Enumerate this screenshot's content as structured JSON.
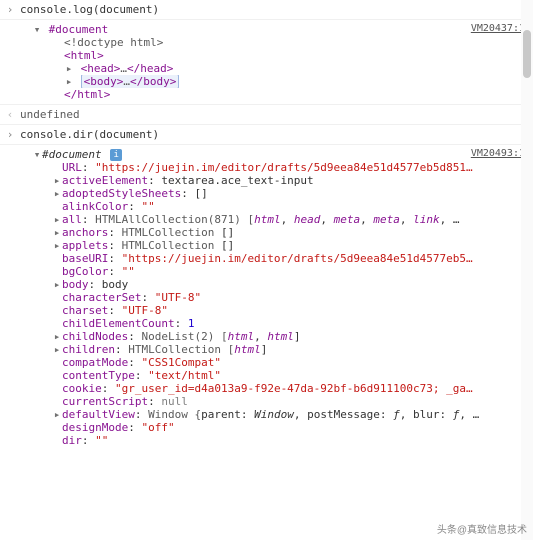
{
  "input1": {
    "code": "console.log(document)",
    "source": "VM20437:1"
  },
  "tree1": {
    "root": "#document",
    "doctype": "<!doctype html>",
    "html_open": "<html>",
    "head": {
      "open": "<head>",
      "ell": "…",
      "close": "</head>"
    },
    "body": {
      "open": "<body>",
      "ell": "…",
      "close": "</body>"
    },
    "html_close": "</html>"
  },
  "return1": "undefined",
  "input2": {
    "code": "console.dir(document)",
    "source": "VM20493:1"
  },
  "tree2": {
    "root": "#document",
    "props": {
      "URL": {
        "type": "str",
        "val": "\"https://juejin.im/editor/drafts/5d9eea84e51d4577eb5d851…"
      },
      "activeElement": {
        "type": "obj",
        "val": "textarea.ace_text-input",
        "expandable": true
      },
      "adoptedStyleSheets": {
        "type": "obj",
        "val": "[]",
        "expandable": true
      },
      "alinkColor": {
        "type": "str",
        "val": "\"\""
      },
      "all": {
        "type": "coll",
        "prefix": "HTMLAllCollection(871) [",
        "items": [
          "html",
          "head",
          "meta",
          "meta",
          "link"
        ],
        "trail": ", …",
        "expandable": true
      },
      "anchors": {
        "type": "coll",
        "prefix": "HTMLCollection ",
        "val": "[]",
        "expandable": true
      },
      "applets": {
        "type": "coll",
        "prefix": "HTMLCollection ",
        "val": "[]",
        "expandable": true
      },
      "baseURI": {
        "type": "str",
        "val": "\"https://juejin.im/editor/drafts/5d9eea84e51d4577eb5…"
      },
      "bgColor": {
        "type": "str",
        "val": "\"\""
      },
      "body": {
        "type": "obj",
        "val": "body",
        "expandable": true
      },
      "characterSet": {
        "type": "str",
        "val": "\"UTF-8\""
      },
      "charset": {
        "type": "str",
        "val": "\"UTF-8\""
      },
      "childElementCount": {
        "type": "num",
        "val": "1"
      },
      "childNodes": {
        "type": "coll",
        "prefix": "NodeList(2) [",
        "items": [
          "html",
          "html"
        ],
        "trail": "]",
        "expandable": true
      },
      "children": {
        "type": "coll",
        "prefix": "HTMLCollection [",
        "items": [
          "html"
        ],
        "trail": "]",
        "expandable": true
      },
      "compatMode": {
        "type": "str",
        "val": "\"CSS1Compat\""
      },
      "contentType": {
        "type": "str",
        "val": "\"text/html\""
      },
      "cookie": {
        "type": "str",
        "val": "\"gr_user_id=d4a013a9-f92e-47da-92bf-b6d911100c73; _ga…"
      },
      "currentScript": {
        "type": "null",
        "val": "null"
      },
      "defaultView": {
        "type": "coll",
        "prefix": "Window {",
        "kv": [
          [
            "parent",
            "Window"
          ],
          [
            "postMessage",
            "ƒ"
          ],
          [
            "blur",
            "ƒ"
          ]
        ],
        "trail": ", …",
        "expandable": true
      },
      "designMode": {
        "type": "str",
        "val": "\"off\""
      },
      "dir": {
        "type": "str",
        "val": "\"\""
      }
    }
  },
  "watermark": "头条@真致信息技术"
}
